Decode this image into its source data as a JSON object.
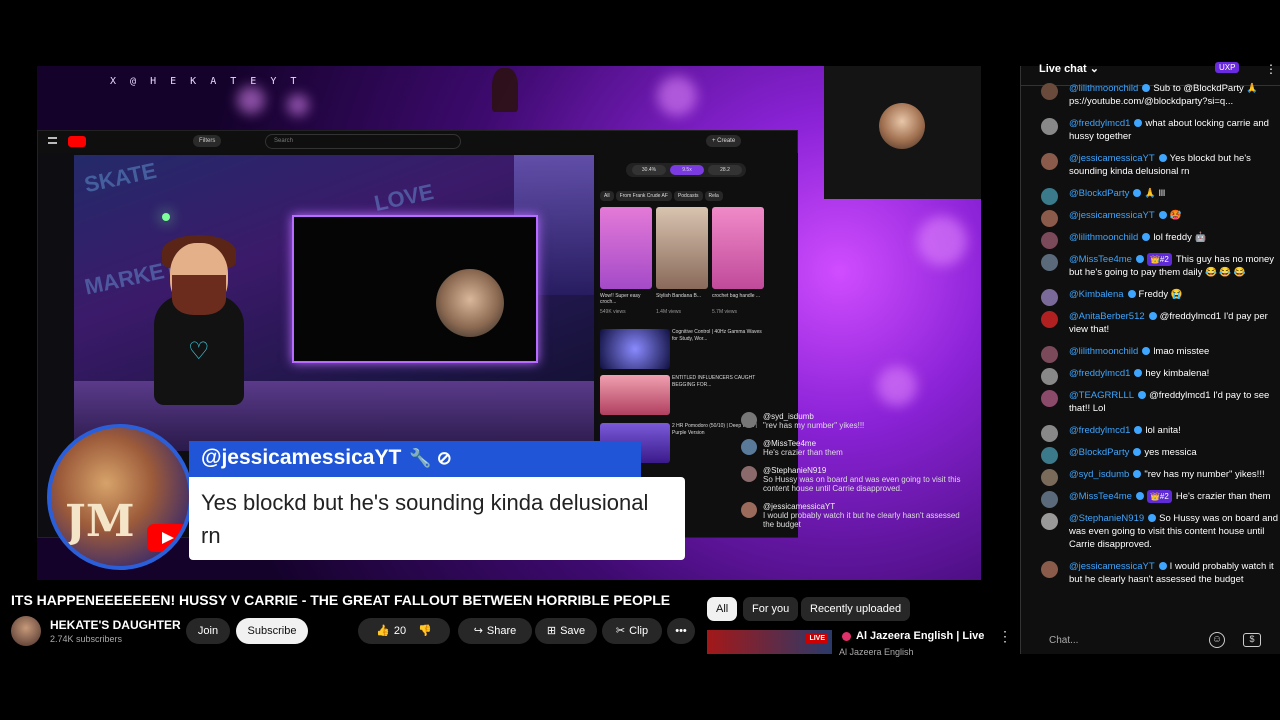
{
  "video": {
    "stream_handle": "X @ H E K A T E Y T",
    "inner": {
      "filters_label": "Filters",
      "search_placeholder": "Search",
      "create_label": "+ Create",
      "pills": [
        "30.4%",
        "9.5x",
        "28.2"
      ],
      "chips": [
        "All",
        "From Frank Crude AF",
        "Podcasts",
        "Rela"
      ],
      "shorts": [
        {
          "title": "Wow!! Super easy croch...",
          "views": "549K views"
        },
        {
          "title": "Stylish Bandana B...",
          "views": "1.4M views"
        },
        {
          "title": "crochet bag handle ...",
          "views": "5.7M views"
        }
      ],
      "videos": [
        {
          "title": "Cognitive Control | 40Hz Gamma Waves for Study, Wor...",
          "duration": "2:15:24"
        },
        {
          "title": "ENTITLED INFLUENCERS CAUGHT BEGGING FOR..."
        },
        {
          "title": "2 HR Pomodoro (50/10) | Deep Work | Purple Version"
        }
      ]
    },
    "overlay_chat": [
      {
        "name": "@syd_isdumb",
        "text": "\"rev has my number\" yikes!!!"
      },
      {
        "name": "@MissTee4me",
        "text": "He's crazier than them"
      },
      {
        "name": "@StephanieN919",
        "text": "So Hussy was on board and was even going to visit this content house until Carrie disapproved."
      },
      {
        "name": "@jessicamessicaYT",
        "text": "I would probably watch it but he clearly hasn't assessed the budget"
      }
    ],
    "banner": {
      "name": "@jessicamessicaYT",
      "tools": "🔧 ⊘",
      "message": "Yes blockd but he's sounding kinda delusional rn",
      "logo_text": "JM"
    }
  },
  "title": "ITS HAPPENEEEEEEEN! HUSSY V CARRIE - THE GREAT FALLOUT BETWEEN HORRIBLE PEOPLE",
  "channel": {
    "name": "HEKATE'S DAUGHTER",
    "subscribers": "2.74K subscribers"
  },
  "actions": {
    "join": "Join",
    "subscribe": "Subscribe",
    "likes": "20",
    "share": "Share",
    "save": "Save",
    "clip": "Clip",
    "more": "•••"
  },
  "recommendations": {
    "chips": [
      "All",
      "For you",
      "Recently uploaded"
    ],
    "first": {
      "title": "Al Jazeera English | Live",
      "channel": "Al Jazeera English",
      "live_badge": "LIVE"
    }
  },
  "chat": {
    "header": "Live chat ⌄",
    "points": "UXP",
    "menu": "⋮",
    "input_placeholder": "Chat...",
    "messages": [
      {
        "author": "@lilithmoonchild",
        "text": "Sub to @BlockdParty 🙏 ps://youtube.com/@blockdparty?si=q..."
      },
      {
        "author": "@freddylmcd1",
        "text": "what about locking carrie and hussy together"
      },
      {
        "author": "@jessicamessicaYT",
        "text": "Yes blockd but he's sounding kinda delusional rn"
      },
      {
        "author": "@BlockdParty",
        "text": "🙏 lll"
      },
      {
        "author": "@jessicamessicaYT",
        "text": "🥵"
      },
      {
        "author": "@lilithmoonchild",
        "text": "lol freddy 🤖"
      },
      {
        "author": "@MissTee4me",
        "badge": "👑#2",
        "text": "This guy has no money but he's going to pay them daily 😂 😂 😂"
      },
      {
        "author": "@Kimbalena",
        "text": "Freddy 😭"
      },
      {
        "author": "@AnitaBerber512",
        "text": "@freddylmcd1 I'd pay per view that!"
      },
      {
        "author": "@lilithmoonchild",
        "text": "lmao misstee"
      },
      {
        "author": "@freddylmcd1",
        "text": "hey kimbalena!"
      },
      {
        "author": "@TEAGRRLLL",
        "text": "@freddylmcd1 I'd pay to see that!! Lol"
      },
      {
        "author": "@freddylmcd1",
        "text": "lol anita!"
      },
      {
        "author": "@BlockdParty",
        "text": "yes messica"
      },
      {
        "author": "@syd_isdumb",
        "text": "\"rev has my number\" yikes!!!"
      },
      {
        "author": "@MissTee4me",
        "badge": "👑#2",
        "text": "He's crazier than them"
      },
      {
        "author": "@StephanieN919",
        "text": "So Hussy was on board and was even going to visit this content house until Carrie disapproved."
      },
      {
        "author": "@jessicamessicaYT",
        "text": "I would probably watch it but he clearly hasn't assessed the budget"
      }
    ]
  },
  "colors": {
    "accent": "#3ea6ff",
    "banner_blue": "#1f55d6",
    "live_red": "#cc0000"
  }
}
